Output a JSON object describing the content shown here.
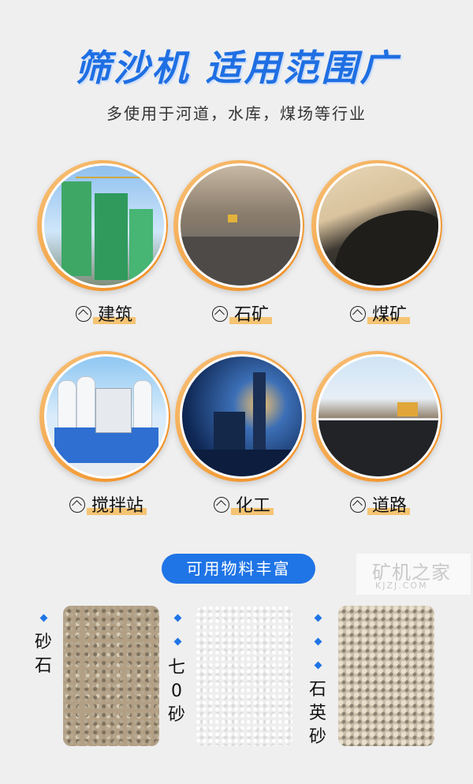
{
  "header": {
    "title": "筛沙机 适用范围广",
    "subtitle": "多使用于河道，水库，煤场等行业"
  },
  "applications": [
    {
      "label": "建筑",
      "icon": "up-arrow-circle-icon"
    },
    {
      "label": "石矿",
      "icon": "up-arrow-circle-icon"
    },
    {
      "label": "煤矿",
      "icon": "up-arrow-circle-icon"
    },
    {
      "label": "搅拌站",
      "icon": "up-arrow-circle-icon"
    },
    {
      "label": "化工",
      "icon": "up-arrow-circle-icon"
    },
    {
      "label": "道路",
      "icon": "up-arrow-circle-icon"
    }
  ],
  "materials_section": {
    "badge": "可用物料丰富",
    "items": [
      {
        "label_chars": [
          "砂",
          "石"
        ]
      },
      {
        "label_chars": [
          "七",
          "0",
          "砂"
        ]
      },
      {
        "label_chars": [
          "石",
          "英",
          "砂"
        ]
      }
    ]
  },
  "watermark": {
    "main": "矿机之家",
    "sub": "KJZJ.COM"
  },
  "colors": {
    "accent": "#1f74e6",
    "highlight": "#f7b64a",
    "ring": "#f08a1a"
  }
}
